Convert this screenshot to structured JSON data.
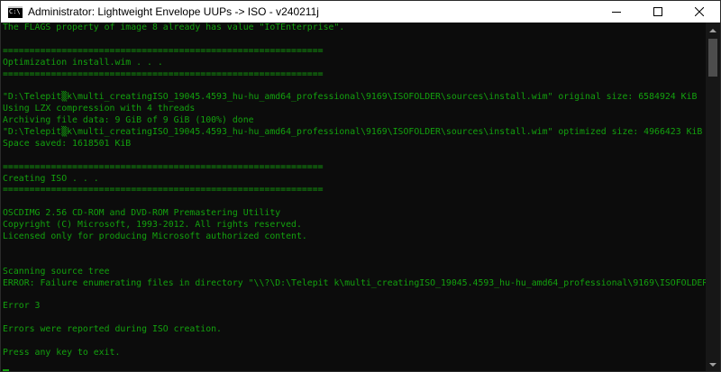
{
  "window": {
    "title": "Administrator:  Lightweight Envelope UUPs -> ISO - v240211j",
    "icon": "cmd-icon"
  },
  "caption_buttons": {
    "minimize": "minimize-icon",
    "maximize": "maximize-icon",
    "close": "close-icon"
  },
  "console": {
    "text_color": "#13a10e",
    "background": "#0c0c0c",
    "lines": [
      "The FLAGS property of image 8 already has value \"IoTEnterprise\".",
      "",
      "============================================================",
      "Optimization install.wim . . .",
      "============================================================",
      "",
      "\"D:\\Telepit▒k\\multi_creatingISO_19045.4593_hu-hu_amd64_professional\\9169\\ISOFOLDER\\sources\\install.wim\" original size: 6584924 KiB",
      "Using LZX compression with 4 threads",
      "Archiving file data: 9 GiB of 9 GiB (100%) done",
      "\"D:\\Telepit▒k\\multi_creatingISO_19045.4593_hu-hu_amd64_professional\\9169\\ISOFOLDER\\sources\\install.wim\" optimized size: 4966423 KiB",
      "Space saved: 1618501 KiB",
      "",
      "============================================================",
      "Creating ISO . . .",
      "============================================================",
      "",
      "OSCDIMG 2.56 CD-ROM and DVD-ROM Premastering Utility",
      "Copyright (C) Microsoft, 1993-2012. All rights reserved.",
      "Licensed only for producing Microsoft authorized content.",
      "",
      "",
      "Scanning source tree",
      "ERROR: Failure enumerating files in directory \"\\\\?\\D:\\Telepit k\\multi_creatingISO_19045.4593_hu-hu_amd64_professional\\9169\\ISOFOLDER\\\"",
      "",
      "Error 3",
      "",
      "Errors were reported during ISO creation.",
      "",
      "Press any key to exit."
    ]
  }
}
